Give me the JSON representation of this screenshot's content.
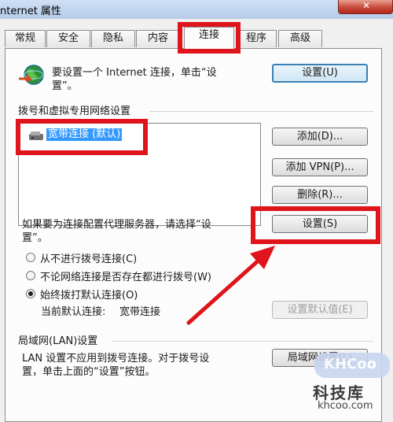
{
  "window": {
    "title": "nternet 属性",
    "close_label": "✕"
  },
  "tabs": [
    "常规",
    "安全",
    "隐私",
    "内容",
    "连接",
    "程序",
    "高级"
  ],
  "setup": {
    "text_line1": "要设置一个 Internet 连接，单击“设",
    "text_line2": "置”。",
    "button": "设置(U)"
  },
  "dialup": {
    "heading": "拨号和虚拟专用网络设置",
    "connections": [
      "宽带连接 (默认)"
    ],
    "add_button": "添加(D)...",
    "add_vpn_button": "添加 VPN(P)...",
    "remove_button": "删除(R)...",
    "proxy_text_line1": "如果要为连接配置代理服务器，请选择“设",
    "proxy_text_line2": "置”。",
    "settings_button": "设置(S)",
    "radios": [
      {
        "label": "从不进行拨号连接(C)",
        "checked": false
      },
      {
        "label": "不论网络连接是否存在都进行拨号(W)",
        "checked": false
      },
      {
        "label": "始终拨打默认连接(O)",
        "checked": true
      }
    ],
    "default_label": "当前默认连接:",
    "default_value": "宽带连接",
    "set_default_button": "设置默认值(E)"
  },
  "lan": {
    "heading": "局域网(LAN)设置",
    "text_line1": "LAN 设置不应用到拨号连接。对于拨号设",
    "text_line2": "置，单击上面的“设置”按钮。",
    "button": "局域网设置(L)"
  },
  "watermark": {
    "logo": "KHCoo",
    "name": "科技库",
    "url": "khcoo.com"
  },
  "colors": {
    "highlight_red": "#e0141b",
    "selection_blue": "#3399ff"
  }
}
